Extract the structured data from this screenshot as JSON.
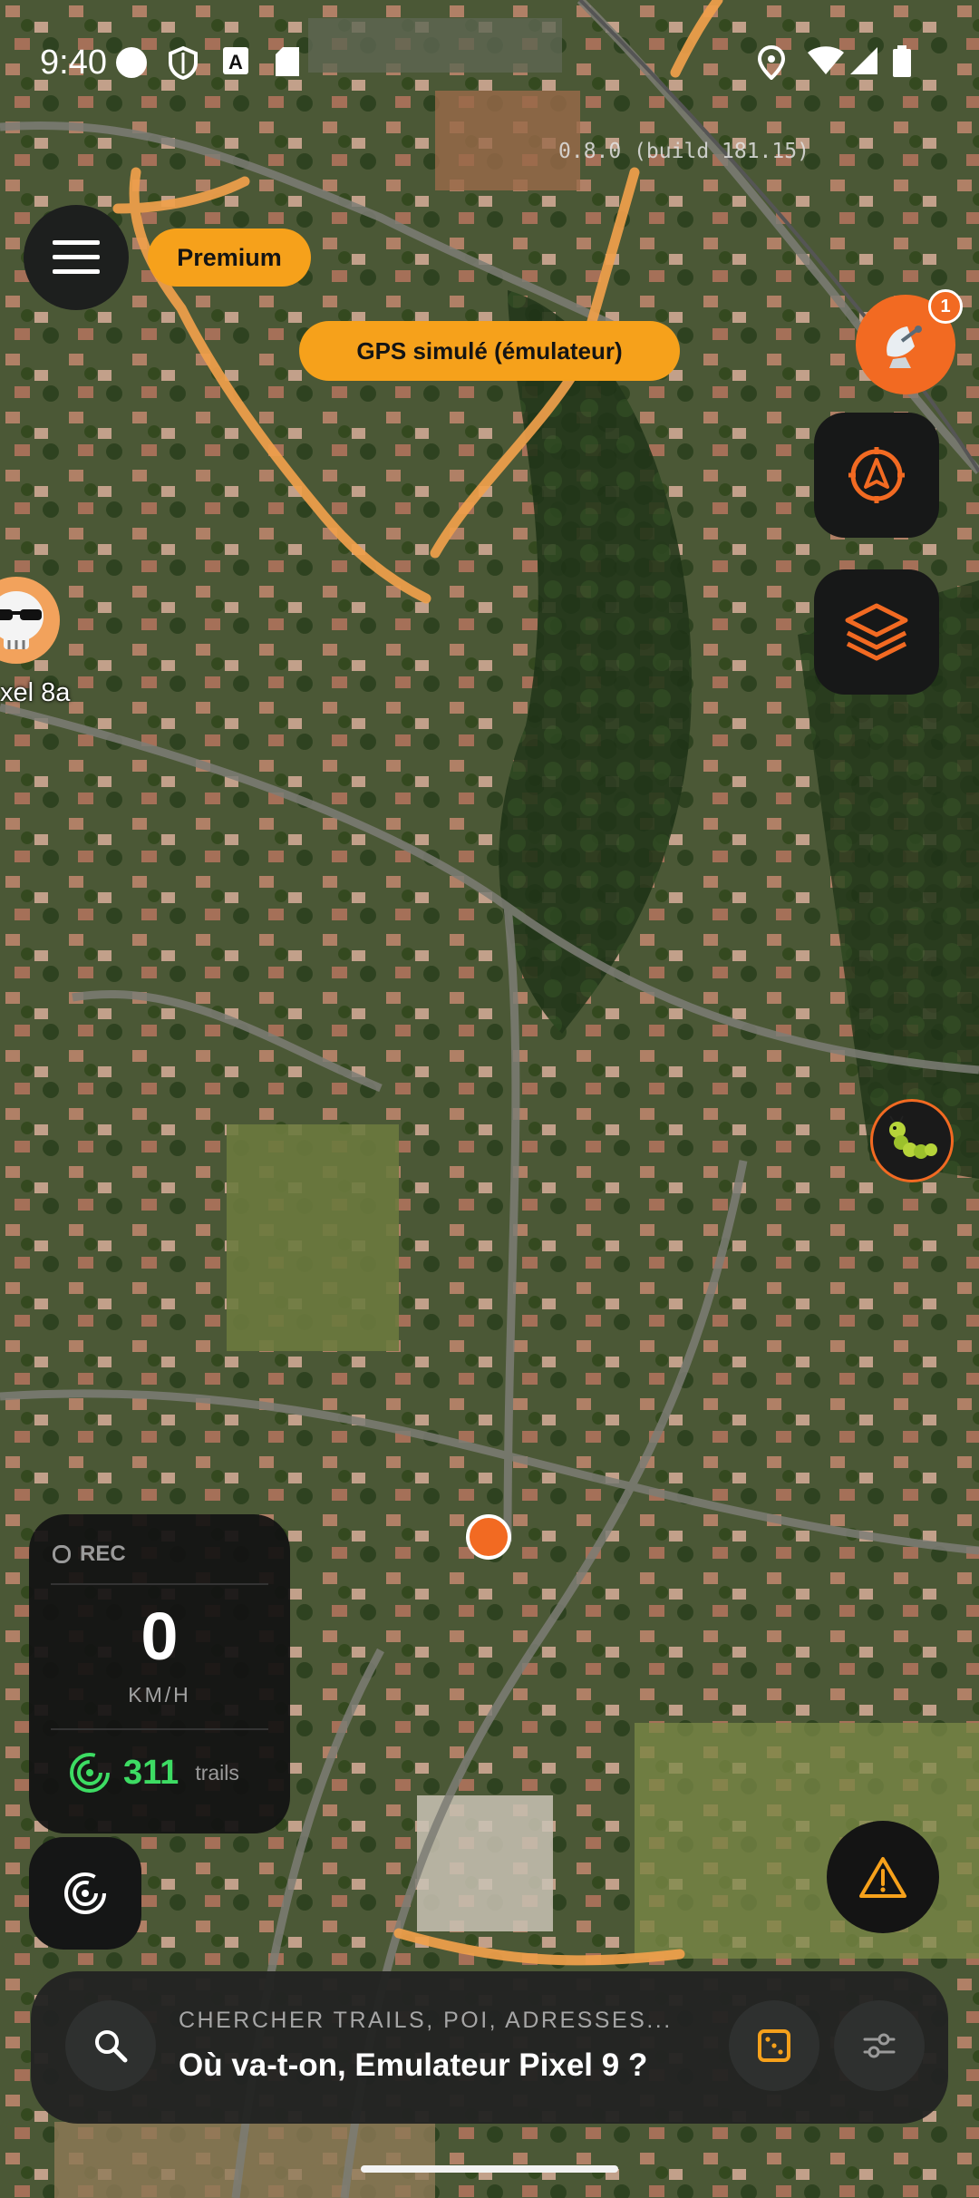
{
  "status_bar": {
    "time": "9:40",
    "left_icons": [
      "circle-icon",
      "shield-icon",
      "a-letter-icon",
      "sd-card-icon"
    ],
    "right_icons": [
      "location-pin-icon",
      "wifi-icon",
      "cell-signal-icon",
      "battery-icon"
    ]
  },
  "build_label": "0.8.0 (build 181.15)",
  "menu": {
    "icon": "hamburger-menu-icon"
  },
  "premium_label": "Premium",
  "gps_banner": "GPS simulé (émulateur)",
  "satellite": {
    "icon": "satellite-dish-icon",
    "badge": "1"
  },
  "right_buttons": [
    "compass-navigation-icon",
    "layers-icon"
  ],
  "avatar": {
    "label": "xel 8a",
    "icon": "skull-with-sunglasses-icon"
  },
  "poi_marker": {
    "icon": "caterpillar-icon"
  },
  "rec_panel": {
    "rec_label": "REC",
    "speed": "0",
    "unit": "KM/H",
    "trails_count": "311",
    "trails_label": "trails"
  },
  "search": {
    "placeholder": "CHERCHER TRAILS, POI, ADRESSES...",
    "value": "Où va-t-on, Emulateur Pixel 9 ?",
    "icons": [
      "search-icon",
      "dice-icon",
      "sliders-icon"
    ]
  },
  "colors": {
    "accent": "#f26a22",
    "pill": "#f6a11b",
    "trails_green": "#3ddc63",
    "trail_line": "#f0a04b"
  }
}
